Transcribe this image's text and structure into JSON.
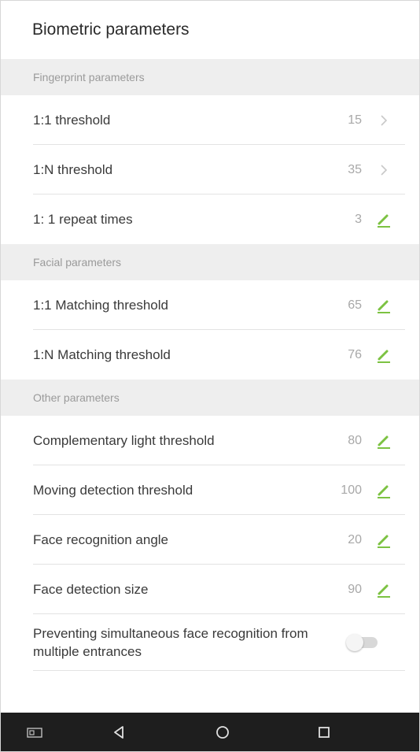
{
  "header": {
    "title": "Biometric parameters"
  },
  "sections": {
    "fingerprint": "Fingerprint parameters",
    "facial": "Facial parameters",
    "other": "Other parameters"
  },
  "rows": {
    "fp_1_1": {
      "label": "1:1 threshold",
      "value": "15"
    },
    "fp_1_n": {
      "label": "1:N threshold",
      "value": "35"
    },
    "fp_repeat": {
      "label": "1: 1 repeat times",
      "value": "3"
    },
    "face_1_1": {
      "label": "1:1 Matching threshold",
      "value": "65"
    },
    "face_1_n": {
      "label": "1:N Matching threshold",
      "value": "76"
    },
    "light": {
      "label": "Complementary light threshold",
      "value": "80"
    },
    "moving": {
      "label": "Moving detection threshold",
      "value": "100"
    },
    "angle": {
      "label": "Face recognition angle",
      "value": "20"
    },
    "size": {
      "label": "Face detection size",
      "value": "90"
    },
    "prevent": {
      "label": "Preventing simultaneous face recognition from multiple entrances",
      "enabled": false
    }
  },
  "colors": {
    "accent": "#7cc242",
    "navbar": "#1e1e1e",
    "section_bg": "#eeeeee"
  },
  "icons": {
    "chevron": "chevron-right-icon",
    "edit": "pencil-icon",
    "nav": [
      "screenshot-icon",
      "back-icon",
      "home-icon",
      "recents-icon"
    ]
  }
}
